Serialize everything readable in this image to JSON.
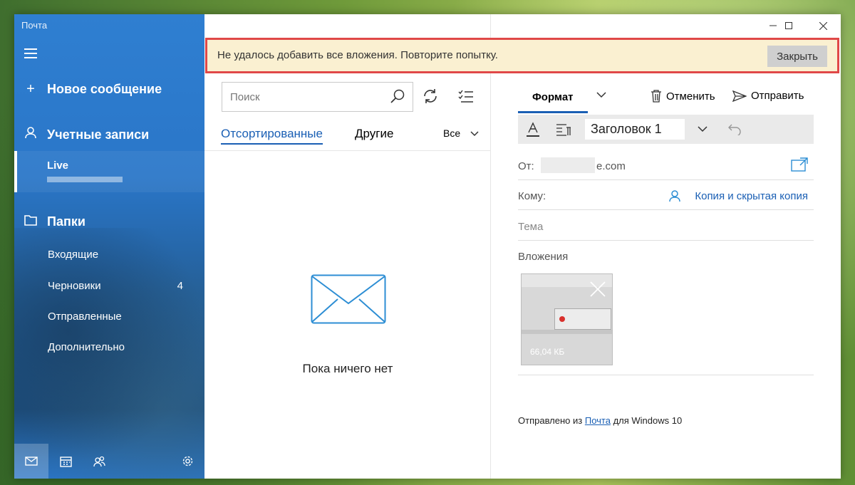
{
  "window": {
    "app_title": "Почта"
  },
  "sidebar": {
    "new_message": "Новое сообщение",
    "accounts": "Учетные записи",
    "account_name": "Live",
    "folders_header": "Папки",
    "folders": [
      {
        "label": "Входящие",
        "count": ""
      },
      {
        "label": "Черновики",
        "count": "4"
      },
      {
        "label": "Отправленные",
        "count": ""
      },
      {
        "label": "Дополнительно",
        "count": ""
      }
    ]
  },
  "notification": {
    "message": "Не удалось добавить все вложения. Повторите попытку.",
    "close_label": "Закрыть"
  },
  "list": {
    "search_placeholder": "Поиск",
    "tab_focused": "Отсортированные",
    "tab_other": "Другие",
    "filter": "Все",
    "empty_text": "Пока ничего нет"
  },
  "compose": {
    "format_tab": "Формат",
    "discard": "Отменить",
    "send": "Отправить",
    "style": "Заголовок 1",
    "from_label": "От:",
    "from_domain": "e.com",
    "to_label": "Кому:",
    "cc_bcc": "Копия и скрытая копия",
    "subject_placeholder": "Тема",
    "attachments_label": "Вложения",
    "attachment_size": "66,04 КБ",
    "signature_prefix": "Отправлено из ",
    "signature_link": "Почта",
    "signature_suffix": " для Windows 10"
  },
  "colors": {
    "accent": "#1a5fb4",
    "sidebar": "#2a76c8",
    "notification_bg": "#faf0d1",
    "highlight_border": "#e04848"
  }
}
